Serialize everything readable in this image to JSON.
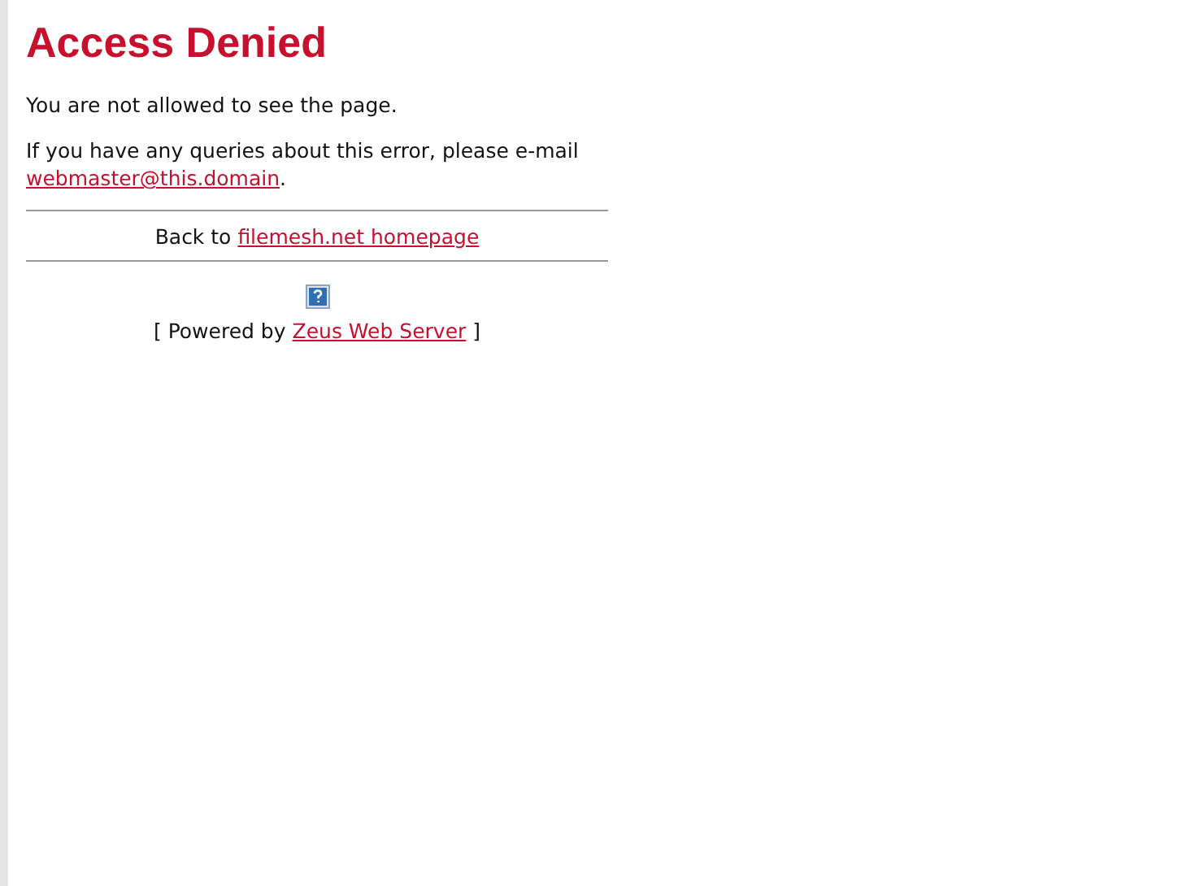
{
  "title": "Access Denied",
  "message": "You are not allowed to see the page.",
  "contact": {
    "before": "If you have any queries about this error, please e-mail",
    "link": "webmaster@this.domain",
    "after": "."
  },
  "back": {
    "before": "Back to",
    "link": "filemesh.net homepage"
  },
  "powered": {
    "before": "[ Powered by",
    "link": "Zeus Web Server",
    "after": "]"
  }
}
